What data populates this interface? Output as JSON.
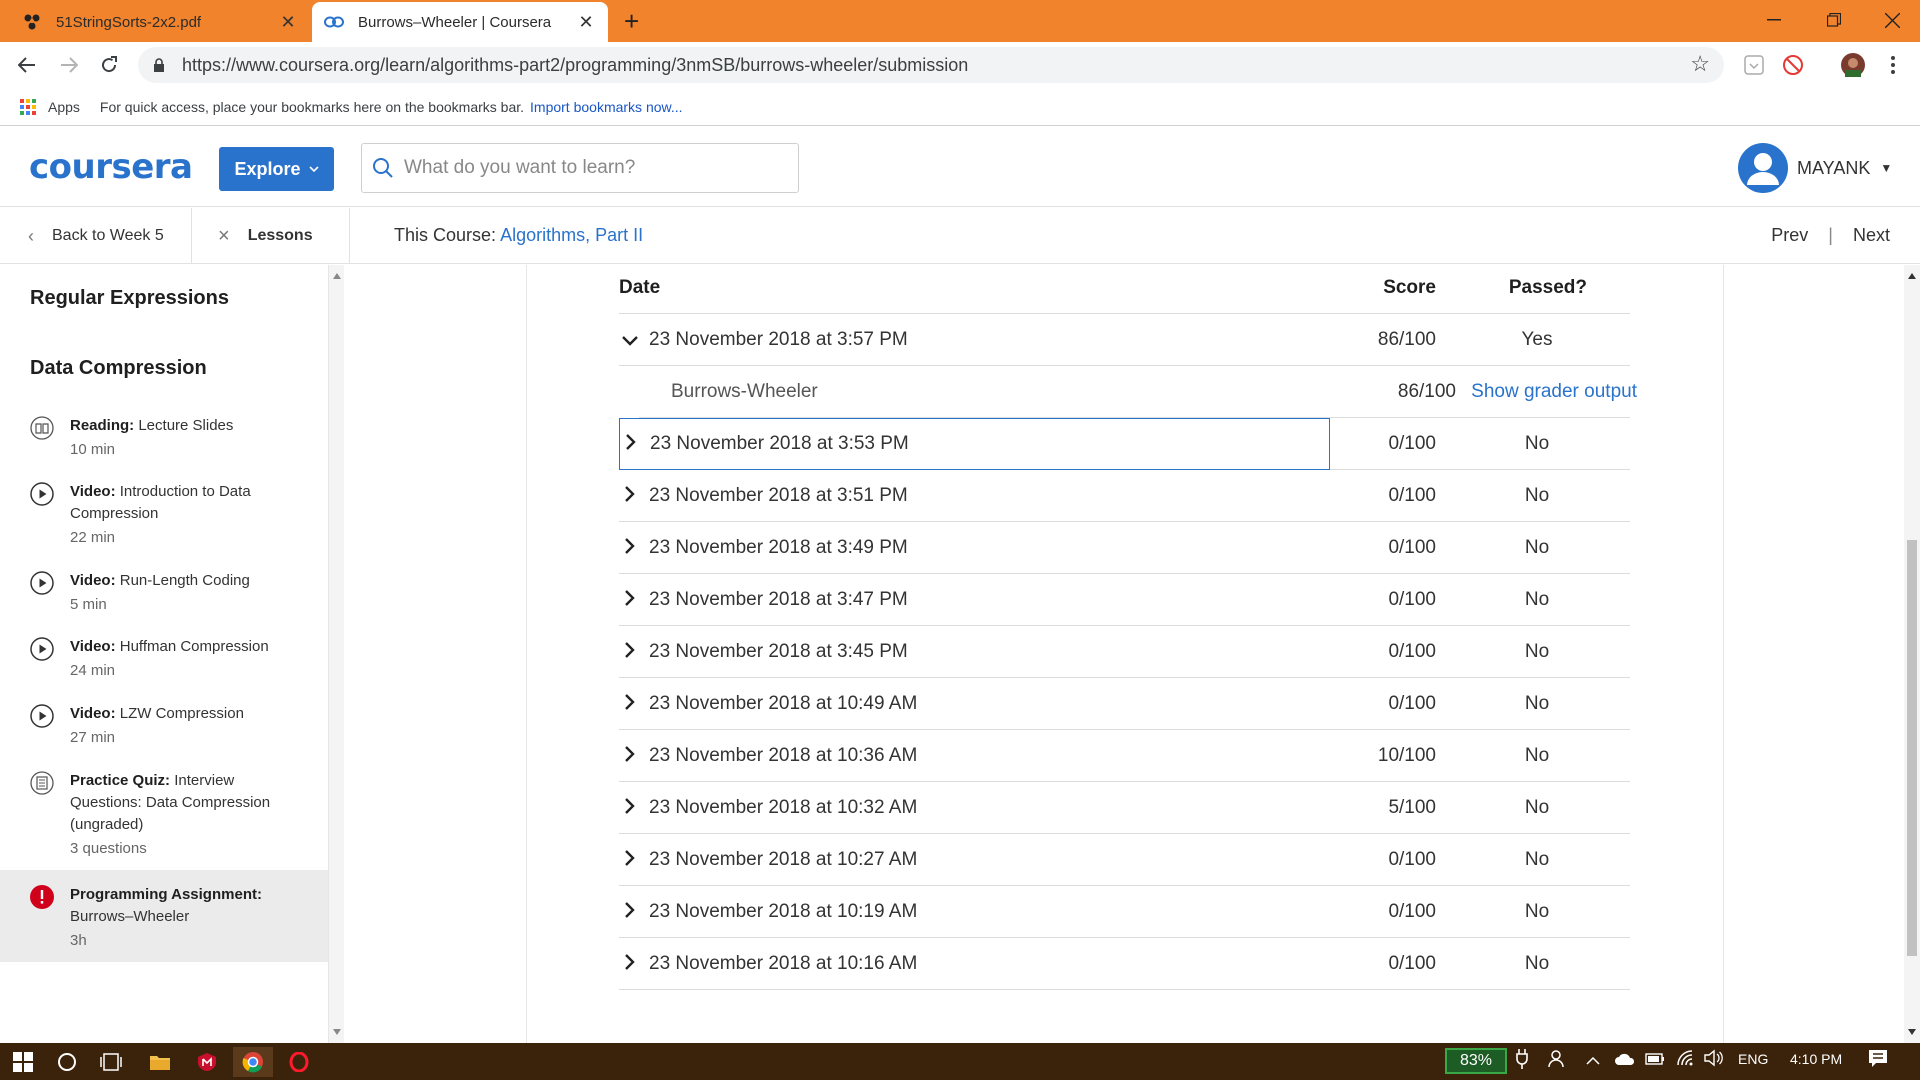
{
  "browser": {
    "tabs": [
      {
        "title": "51StringSorts-2x2.pdf",
        "active": false
      },
      {
        "title": "Burrows–Wheeler | Coursera",
        "active": true
      }
    ],
    "url": "https://www.coursera.org/learn/algorithms-part2/programming/3nmSB/burrows-wheeler/submission",
    "bookmarks_bar": {
      "apps_label": "Apps",
      "hint": "For quick access, place your bookmarks here on the bookmarks bar.",
      "import_link": "Import bookmarks now..."
    }
  },
  "header": {
    "logo": "coursera",
    "explore_label": "Explore",
    "search_placeholder": "What do you want to learn?",
    "username": "MAYANK"
  },
  "subnav": {
    "back_label": "Back to Week 5",
    "lessons_label": "Lessons",
    "course_prefix": "This Course:",
    "course_name": "Algorithms, Part II",
    "prev_label": "Prev",
    "next_label": "Next"
  },
  "sidebar": {
    "sections": [
      {
        "title": "Regular Expressions"
      },
      {
        "title": "Data Compression"
      }
    ],
    "items": [
      {
        "type": "Reading:",
        "title": "Lecture Slides",
        "duration": "10 min",
        "icon": "book-icon"
      },
      {
        "type": "Video:",
        "title": "Introduction to Data Compression",
        "duration": "22 min",
        "icon": "play-icon"
      },
      {
        "type": "Video:",
        "title": "Run-Length Coding",
        "duration": "5 min",
        "icon": "play-icon"
      },
      {
        "type": "Video:",
        "title": "Huffman Compression",
        "duration": "24 min",
        "icon": "play-icon"
      },
      {
        "type": "Video:",
        "title": "LZW Compression",
        "duration": "27 min",
        "icon": "play-icon"
      },
      {
        "type": "Practice Quiz:",
        "title": "Interview Questions: Data Compression (ungraded)",
        "duration": "3 questions",
        "icon": "quiz-icon"
      },
      {
        "type": "Programming Assignment:",
        "title": "Burrows–Wheeler",
        "duration": "3h",
        "icon": "alert-icon"
      }
    ]
  },
  "submissions": {
    "columns": {
      "date": "Date",
      "score": "Score",
      "passed": "Passed?"
    },
    "expanded": {
      "date": "23 November 2018 at 3:57 PM",
      "score": "86/100",
      "passed": "Yes",
      "detail": {
        "part": "Burrows-Wheeler",
        "score": "86/100",
        "link": "Show grader output"
      }
    },
    "rows": [
      {
        "date": "23 November 2018 at 3:53 PM",
        "score": "0/100",
        "passed": "No"
      },
      {
        "date": "23 November 2018 at 3:51 PM",
        "score": "0/100",
        "passed": "No"
      },
      {
        "date": "23 November 2018 at 3:49 PM",
        "score": "0/100",
        "passed": "No"
      },
      {
        "date": "23 November 2018 at 3:47 PM",
        "score": "0/100",
        "passed": "No"
      },
      {
        "date": "23 November 2018 at 3:45 PM",
        "score": "0/100",
        "passed": "No"
      },
      {
        "date": "23 November 2018 at 10:49 AM",
        "score": "0/100",
        "passed": "No"
      },
      {
        "date": "23 November 2018 at 10:36 AM",
        "score": "10/100",
        "passed": "No"
      },
      {
        "date": "23 November 2018 at 10:32 AM",
        "score": "5/100",
        "passed": "No"
      },
      {
        "date": "23 November 2018 at 10:27 AM",
        "score": "0/100",
        "passed": "No"
      },
      {
        "date": "23 November 2018 at 10:19 AM",
        "score": "0/100",
        "passed": "No"
      },
      {
        "date": "23 November 2018 at 10:16 AM",
        "score": "0/100",
        "passed": "No"
      }
    ]
  },
  "taskbar": {
    "battery": "83%",
    "language": "ENG",
    "time": "4:10 PM"
  },
  "colors": {
    "titlebar": "#f0832b",
    "accent": "#2a73cc",
    "taskbar": "#3b220a",
    "alert": "#d0021b"
  }
}
